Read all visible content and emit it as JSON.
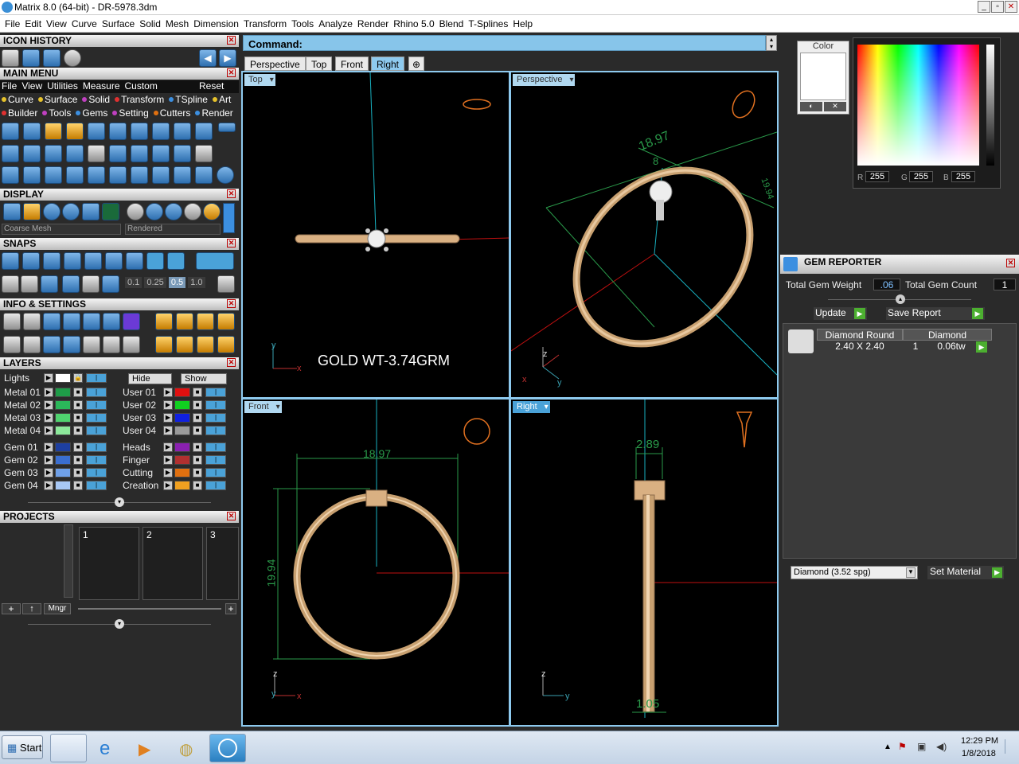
{
  "window": {
    "title": "Matrix 8.0 (64-bit) - DR-5978.3dm"
  },
  "menubar": [
    "File",
    "Edit",
    "View",
    "Curve",
    "Surface",
    "Solid",
    "Mesh",
    "Dimension",
    "Transform",
    "Tools",
    "Analyze",
    "Render",
    "Rhino 5.0",
    "Blend",
    "T-Splines",
    "Help"
  ],
  "icon_history": {
    "title": "ICON HISTORY"
  },
  "main_menu": {
    "title": "MAIN MENU",
    "row1": [
      "File",
      "View",
      "Utilities",
      "Measure",
      "Custom"
    ],
    "reset": "Reset",
    "row2": [
      "Curve",
      "Surface",
      "Solid",
      "Transform",
      "TSpline",
      "Art"
    ],
    "row3": [
      "Builder",
      "Tools",
      "Gems",
      "Setting",
      "Cutters",
      "Render"
    ]
  },
  "display": {
    "title": "DISPLAY",
    "mesh_select": "Coarse Mesh",
    "render_select": "Rendered"
  },
  "snaps": {
    "title": "SNAPS",
    "values": [
      "0.1",
      "0.25",
      "0.5",
      "1.0"
    ]
  },
  "info_settings": {
    "title": "INFO & SETTINGS"
  },
  "layers": {
    "title": "LAYERS",
    "lights": "Lights",
    "hide": "Hide",
    "show": "Show",
    "left": [
      {
        "name": "Metal 01",
        "color": "#1e9c48"
      },
      {
        "name": "Metal 02",
        "color": "#2bb85a"
      },
      {
        "name": "Metal 03",
        "color": "#4fd36f"
      },
      {
        "name": "Metal 04",
        "color": "#8ce89a"
      },
      {
        "name": "Gem 01",
        "color": "#1d3fa0"
      },
      {
        "name": "Gem 02",
        "color": "#3a6ed0"
      },
      {
        "name": "Gem 03",
        "color": "#6fa0e8"
      },
      {
        "name": "Gem 04",
        "color": "#a8c8f5"
      }
    ],
    "right": [
      {
        "name": "User 01",
        "color": "#e01010"
      },
      {
        "name": "User 02",
        "color": "#10d020"
      },
      {
        "name": "User 03",
        "color": "#1020e0"
      },
      {
        "name": "User 04",
        "color": "#9a9a9a"
      },
      {
        "name": "Heads",
        "color": "#8a20b0"
      },
      {
        "name": "Finger",
        "color": "#b03030"
      },
      {
        "name": "Cutting",
        "color": "#e07010"
      },
      {
        "name": "Creation",
        "color": "#f0a020"
      }
    ]
  },
  "projects": {
    "title": "PROJECTS",
    "slots": [
      "1",
      "2",
      "3"
    ],
    "mngr": "Mngr"
  },
  "command": {
    "label": "Command:"
  },
  "tabs": [
    "Perspective",
    "Top",
    "Front",
    "Right"
  ],
  "viewports": {
    "top": {
      "label": "Top",
      "annotation": "GOLD WT-3.74GRM"
    },
    "perspective": {
      "label": "Perspective",
      "dim1": "18.97",
      "dim2": "19.94",
      "dim3": "8"
    },
    "front": {
      "label": "Front",
      "width": "18.97",
      "height": "19.94"
    },
    "right": {
      "label": "Right",
      "top_dim": "2.89",
      "bottom_dim": "1.05"
    }
  },
  "color_panel": {
    "title": "Color",
    "r": "255",
    "g": "255",
    "b": "255",
    "r_label": "R",
    "g_label": "G",
    "b_label": "B"
  },
  "gem_reporter": {
    "title": "GEM REPORTER",
    "total_weight_label": "Total Gem Weight",
    "total_weight": ".06",
    "total_count_label": "Total Gem Count",
    "total_count": "1",
    "update": "Update",
    "save_report": "Save Report",
    "row": {
      "shape": "Diamond Round",
      "size": "2.40 X 2.40",
      "material": "Diamond",
      "count": "1",
      "weight": "0.06tw"
    },
    "material_select": "Diamond     (3.52 spg)",
    "set_material": "Set Material"
  },
  "taskbar": {
    "start": "Start",
    "time": "12:29 PM",
    "date": "1/8/2018"
  }
}
